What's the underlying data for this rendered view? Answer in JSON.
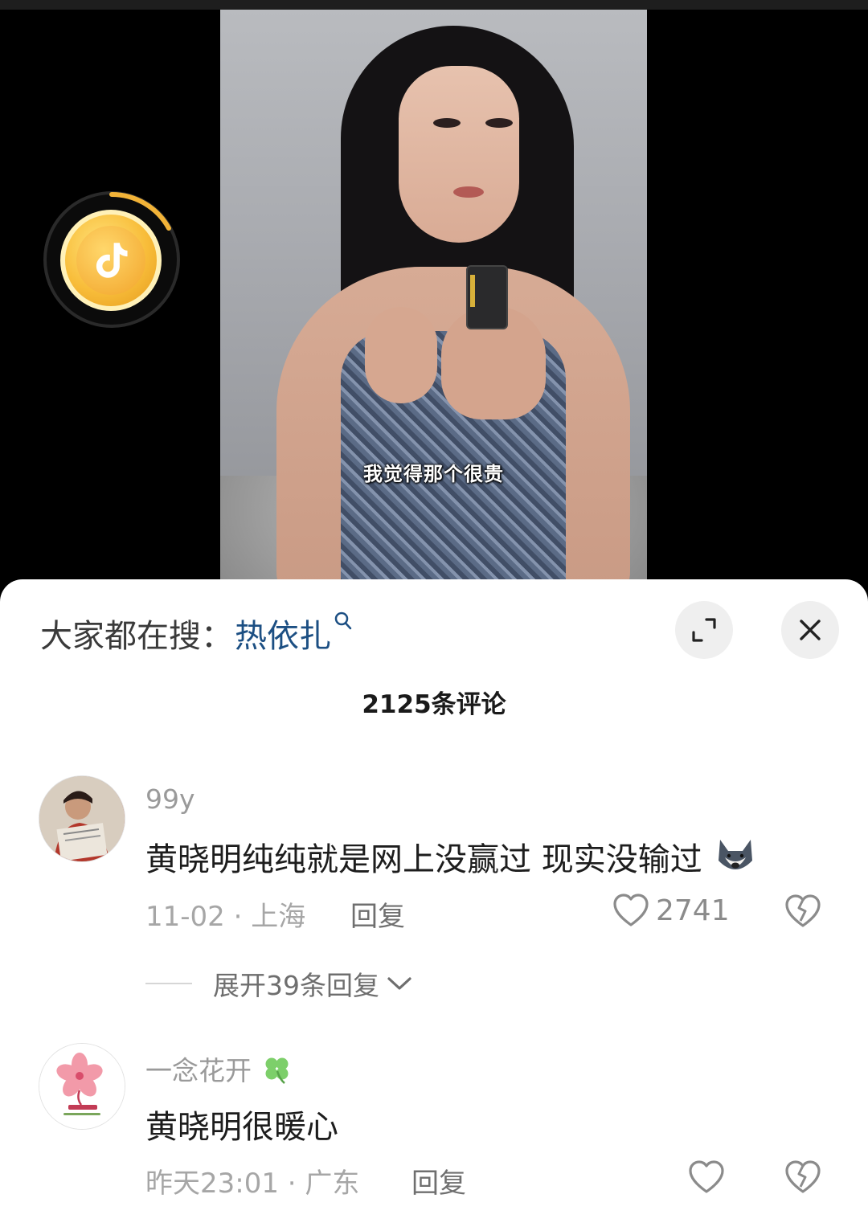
{
  "video": {
    "subtitle": "我觉得那个很贵"
  },
  "coin_badge": {
    "icon": "tiktok-coin-icon",
    "progress": 0.17
  },
  "sheet": {
    "hot_search_prefix": "大家都在搜：",
    "hot_search_term": "热依扎",
    "comment_count_title": "2125条评论",
    "icons": {
      "expand": "expand-icon",
      "close": "close-icon",
      "search": "search-icon"
    }
  },
  "comments": [
    {
      "username": "99y",
      "text": "黄晓明纯纯就是网上没赢过  现实没输过",
      "emoji": "husky-dog-emoji",
      "date": "11-02",
      "location": "上海",
      "reply_label": "回复",
      "likes": "2741",
      "expand_replies": "展开39条回复"
    },
    {
      "username": "一念花开",
      "username_emoji": "four-leaf-clover-emoji",
      "text": "黄晓明很暖心",
      "date": "昨天23:01",
      "location": "广东",
      "reply_label": "回复",
      "likes": ""
    }
  ],
  "colors": {
    "hot_search_term": "#1c4f83",
    "coin": "#f8bd3a",
    "sheet_bg": "#ffffff"
  }
}
